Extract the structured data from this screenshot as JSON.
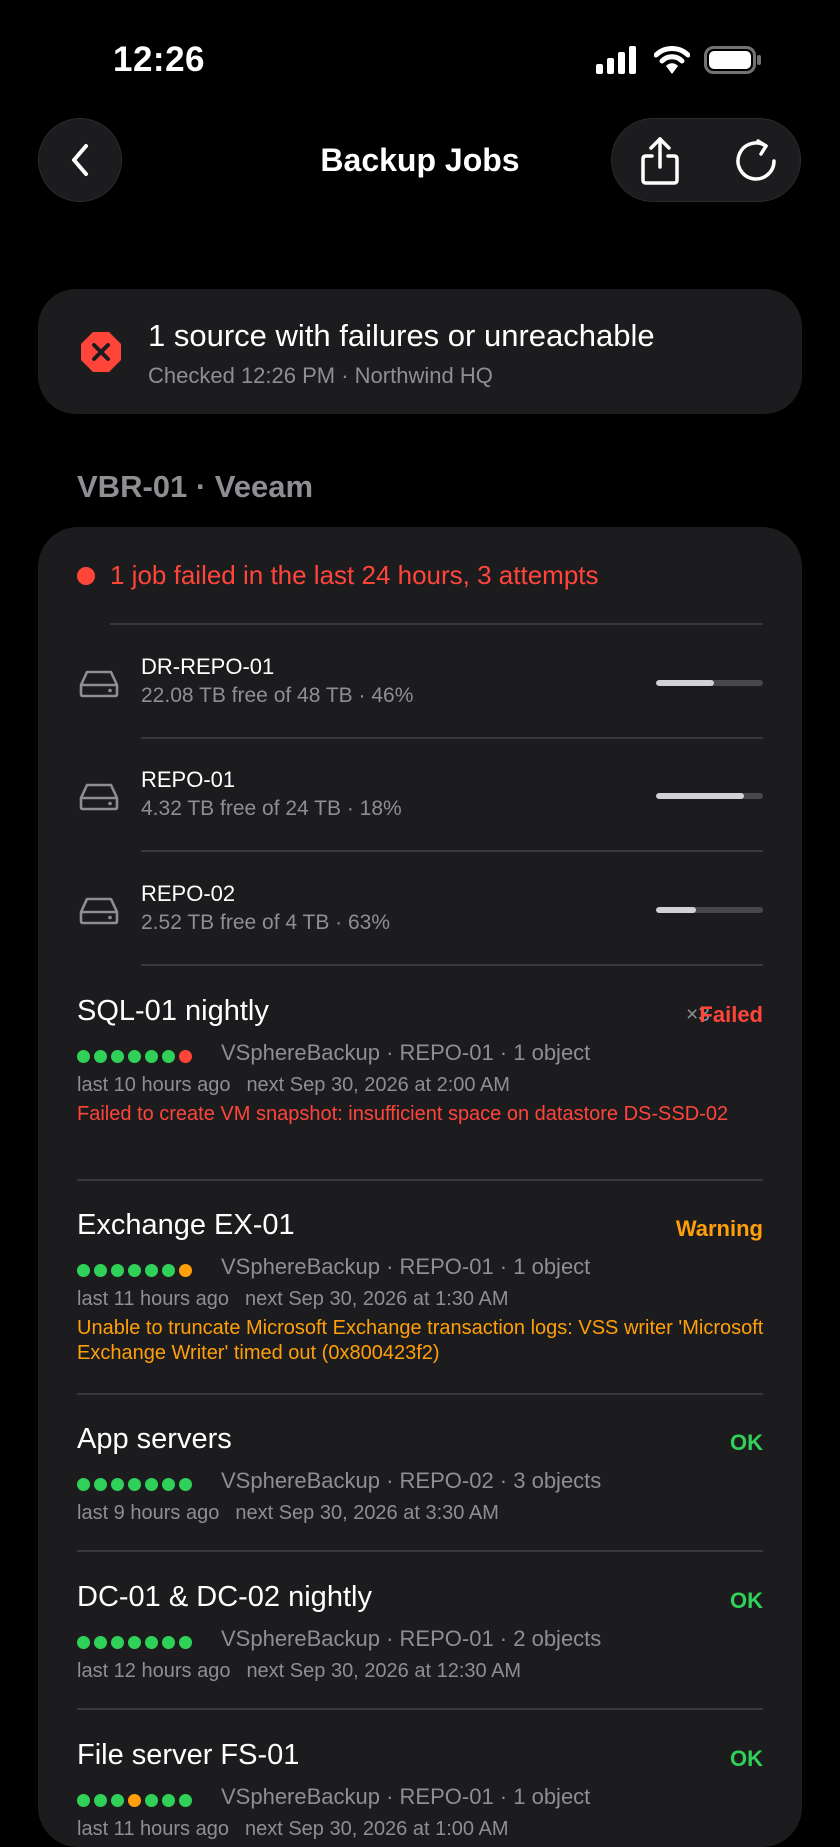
{
  "status_bar": {
    "time": "12:26"
  },
  "nav": {
    "title": "Backup Jobs"
  },
  "banner": {
    "title": "1 source with failures or unreachable",
    "subtitle": "Checked 12:26 PM · Northwind HQ"
  },
  "section": {
    "title": "VBR-01 · Veeam",
    "summary": "1 job failed in the last 24 hours, 3 attempts",
    "repositories": [
      {
        "name": "DR-REPO-01",
        "detail": "22.08 TB free of 48 TB · 46%",
        "used_fraction": 0.54
      },
      {
        "name": "REPO-01",
        "detail": "4.32 TB free of 24 TB · 18%",
        "used_fraction": 0.82
      },
      {
        "name": "REPO-02",
        "detail": "2.52 TB free of 4 TB · 63%",
        "used_fraction": 0.37
      }
    ],
    "jobs": [
      {
        "name": "SQL-01 nightly",
        "attempts": "×3",
        "status": "Failed",
        "status_color": "#ff453a",
        "history": [
          "ok",
          "ok",
          "ok",
          "ok",
          "ok",
          "ok",
          "fail"
        ],
        "meta": "VSphereBackup · REPO-01 · 1 object",
        "last": "last 10 hours ago",
        "next": "next Sep 30, 2026 at 2:00 AM",
        "error": "Failed to create VM snapshot: insufficient space on datastore DS-SSD-02",
        "error_color": "#ff453a"
      },
      {
        "name": "Exchange EX-01",
        "attempts": "",
        "status": "Warning",
        "status_color": "#ff9f0a",
        "history": [
          "ok",
          "ok",
          "ok",
          "ok",
          "ok",
          "ok",
          "warn"
        ],
        "meta": "VSphereBackup · REPO-01 · 1 object",
        "last": "last 11 hours ago",
        "next": "next Sep 30, 2026 at 1:30 AM",
        "error": "Unable to truncate Microsoft Exchange transaction logs: VSS writer 'Microsoft Exchange Writer' timed out (0x800423f2)",
        "error_color": "#ff9f0a"
      },
      {
        "name": "App servers",
        "attempts": "",
        "status": "OK",
        "status_color": "#30d158",
        "history": [
          "ok",
          "ok",
          "ok",
          "ok",
          "ok",
          "ok",
          "ok"
        ],
        "meta": "VSphereBackup · REPO-02 · 3 objects",
        "last": "last 9 hours ago",
        "next": "next Sep 30, 2026 at 3:30 AM",
        "error": "",
        "error_color": ""
      },
      {
        "name": "DC-01 & DC-02 nightly",
        "attempts": "",
        "status": "OK",
        "status_color": "#30d158",
        "history": [
          "ok",
          "ok",
          "ok",
          "ok",
          "ok",
          "ok",
          "ok"
        ],
        "meta": "VSphereBackup · REPO-01 · 2 objects",
        "last": "last 12 hours ago",
        "next": "next Sep 30, 2026 at 12:30 AM",
        "error": "",
        "error_color": ""
      },
      {
        "name": "File server FS-01",
        "attempts": "",
        "status": "OK",
        "status_color": "#30d158",
        "history": [
          "ok",
          "ok",
          "ok",
          "warn",
          "ok",
          "ok",
          "ok"
        ],
        "meta": "VSphereBackup · REPO-01 · 1 object",
        "last": "last 11 hours ago",
        "next": "next Sep 30, 2026 at 1:00 AM",
        "error": "",
        "error_color": ""
      }
    ]
  },
  "colors": {
    "ok": "#30d158",
    "warn": "#ff9f0a",
    "fail": "#ff453a",
    "secondary": "#8e8e93"
  }
}
